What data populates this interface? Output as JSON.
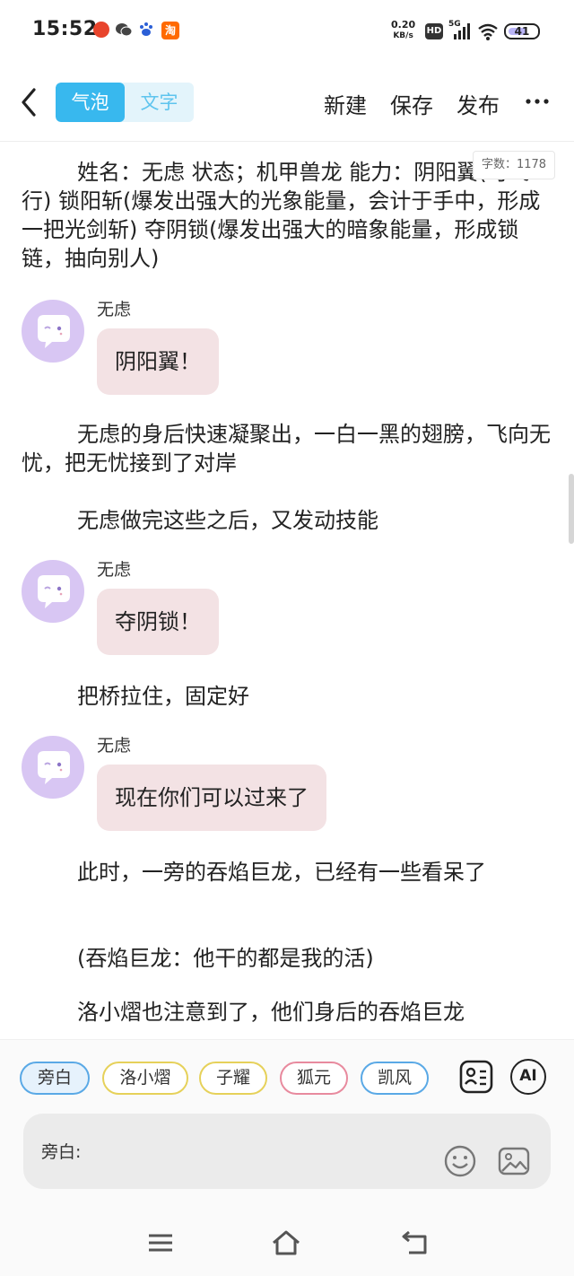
{
  "status_bar": {
    "time": "15:52",
    "net_speed": "0.20",
    "net_unit": "KB/s",
    "hd": "HD",
    "signal_label": "5G",
    "battery": "41",
    "notification_icons": [
      "weibo-icon",
      "wechat-icon",
      "baidu-icon",
      "taobao-icon"
    ]
  },
  "nav": {
    "modes": [
      {
        "label": "气泡",
        "active": true
      },
      {
        "label": "文字",
        "active": false
      }
    ],
    "new_label": "新建",
    "save_label": "保存",
    "publish_label": "发布",
    "more_icon": "more-dots-icon",
    "accent_color": "#38b8ee"
  },
  "content": {
    "word_count": "字数：1178",
    "items": [
      {
        "type": "narration",
        "text": "姓名：无虑 状态；机甲兽龙 能力：阴阳翼(可飞行) 锁阳斩(爆发出强大的光象能量，会计于手中，形成一把光剑斩) 夺阴锁(爆发出强大的暗象能量，形成锁链，抽向别人)"
      },
      {
        "type": "bubble",
        "speaker": "无虑",
        "text": "阴阳翼！"
      },
      {
        "type": "narration",
        "text": "无虑的身后快速凝聚出，一白一黑的翅膀，飞向无忧，把无忧接到了对岸"
      },
      {
        "type": "narration",
        "text": "无虑做完这些之后，又发动技能"
      },
      {
        "type": "bubble",
        "speaker": "无虑",
        "text": "夺阴锁！"
      },
      {
        "type": "narration",
        "text": "把桥拉住，固定好"
      },
      {
        "type": "bubble",
        "speaker": "无虑",
        "text": "现在你们可以过来了"
      },
      {
        "type": "narration",
        "text": "此时，一旁的吞焰巨龙，已经有一些看呆了"
      },
      {
        "type": "narration",
        "text": "(吞焰巨龙：他干的都是我的活)"
      },
      {
        "type": "narration",
        "text": "洛小熠也注意到了，他们身后的吞焰巨龙"
      }
    ],
    "bubble_color": "#f3e2e4",
    "avatar_color": "#d8c6f3"
  },
  "characters": [
    {
      "label": "旁白",
      "color": "#5aa9e6",
      "selected": true
    },
    {
      "label": "洛小熠",
      "color": "#e6d15a"
    },
    {
      "label": "子耀",
      "color": "#e6d15a"
    },
    {
      "label": "狐元",
      "color": "#e88a9e"
    },
    {
      "label": "凯风",
      "color": "#5aa9e6"
    }
  ],
  "tools": {
    "roles_icon": "character-list-icon",
    "ai_label": "AI"
  },
  "input": {
    "label": "旁白:",
    "emoji_icon": "emoji-icon",
    "image_icon": "image-icon"
  },
  "system_nav": [
    "menu-icon",
    "home-icon",
    "back-icon"
  ]
}
